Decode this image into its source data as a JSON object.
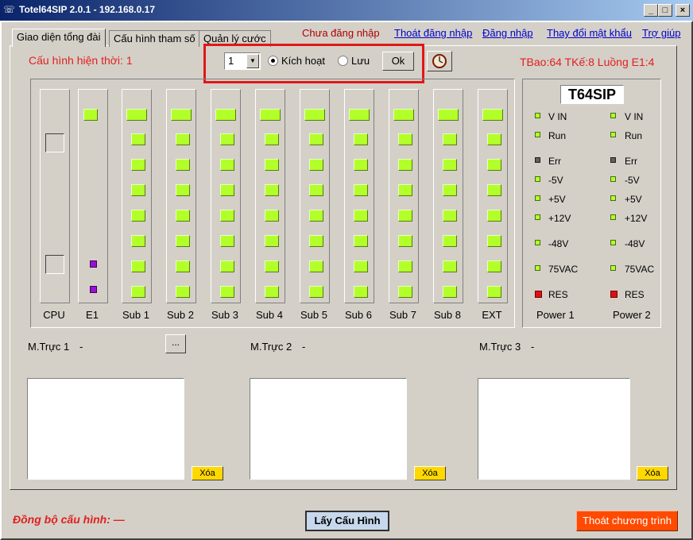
{
  "window": {
    "title": "Totel64SIP 2.0.1 - 192.168.0.17",
    "controls": [
      "_",
      "□",
      "×"
    ]
  },
  "tabs": [
    {
      "label": "Giao diện tổng đài",
      "active": true
    },
    {
      "label": "Cấu hình tham số",
      "active": false
    },
    {
      "label": "Quản lý cước",
      "active": false
    }
  ],
  "header": {
    "login_status": "Chưa đăng nhập",
    "links": [
      "Thoát đăng nhập",
      "Đăng nhập",
      "Thay đổi mật khẩu",
      "Trợ giúp"
    ]
  },
  "config_bar": {
    "current_config": "Cấu hình hiện thời: 1",
    "select_value": "1",
    "radio_activate": "Kích hoạt",
    "radio_save": "Lưu",
    "ok": "Ok",
    "selected_radio": "Kích hoạt"
  },
  "summary": "TBao:64 TKế:8 Luồng E1:4",
  "rack": {
    "slots": [
      "CPU",
      "E1",
      "Sub 1",
      "Sub 2",
      "Sub 3",
      "Sub 4",
      "Sub 5",
      "Sub 6",
      "Sub 7",
      "Sub 8",
      "EXT"
    ]
  },
  "power": {
    "model": "T64SIP",
    "labels": [
      "V IN",
      "Run",
      "Err",
      "-5V",
      "+5V",
      "+12V",
      "-48V",
      "75VAC",
      "RES"
    ],
    "units": [
      "Power 1",
      "Power 2"
    ]
  },
  "trunks": [
    {
      "label": "M.Trực 1",
      "value": "-",
      "clear": "Xóa"
    },
    {
      "label": "M.Trực 2",
      "value": "-",
      "clear": "Xóa"
    },
    {
      "label": "M.Trực 3",
      "value": "-",
      "clear": "Xóa"
    }
  ],
  "dots_button": "...",
  "footer": {
    "sync_status": "Đồng bộ cấu hình: —",
    "get_config": "Lấy Cấu Hình",
    "exit": "Thoát chương trình"
  },
  "colors": {
    "accent_red": "#e02020",
    "led_green": "#b2ff2a",
    "exit_orange": "#ff4a00",
    "clear_yellow": "#ffd800"
  }
}
